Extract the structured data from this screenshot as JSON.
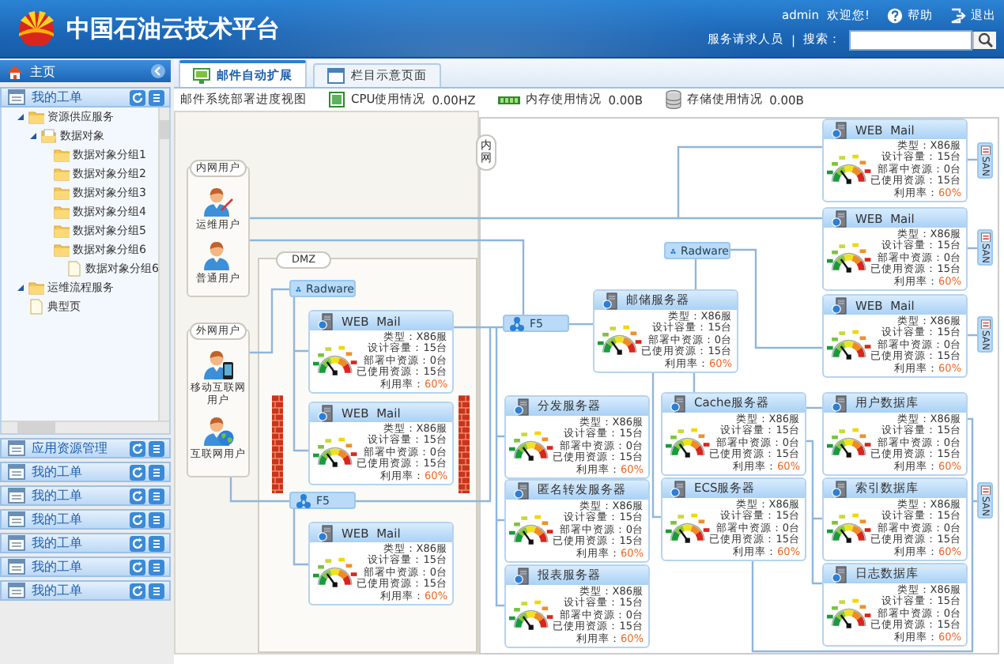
{
  "header": {
    "title": "中国石油云技术平台",
    "user": "admin",
    "welcome": "欢迎您!",
    "help": "帮助",
    "logout": "退出",
    "role": "服务请求人员",
    "separator": "|",
    "search_label": "搜索："
  },
  "sidebar": {
    "home": "主页",
    "panel_title": "我的工单",
    "tree": [
      {
        "label": "资源供应服务",
        "kind": "folder",
        "expanded": true,
        "children": [
          {
            "label": "数据对象",
            "kind": "folder-open",
            "expanded": true,
            "children": [
              {
                "label": "数据对象分组1",
                "kind": "folder"
              },
              {
                "label": "数据对象分组2",
                "kind": "folder"
              },
              {
                "label": "数据对象分组3",
                "kind": "folder"
              },
              {
                "label": "数据对象分组4",
                "kind": "folder"
              },
              {
                "label": "数据对象分组5",
                "kind": "folder"
              },
              {
                "label": "数据对象分组6",
                "kind": "folder",
                "children": [
                  {
                    "label": "数据对象分组6",
                    "kind": "file"
                  }
                ]
              }
            ]
          }
        ]
      },
      {
        "label": "运维流程服务",
        "kind": "folder",
        "expanded": true
      },
      {
        "label": "典型页",
        "kind": "file"
      }
    ],
    "accordions": [
      {
        "label": "应用资源管理"
      },
      {
        "label": "我的工单"
      },
      {
        "label": "我的工单"
      },
      {
        "label": "我的工单"
      },
      {
        "label": "我的工单"
      },
      {
        "label": "我的工单"
      },
      {
        "label": "我的工单"
      }
    ]
  },
  "tabs": [
    {
      "label": "邮件自动扩展",
      "selected": true
    },
    {
      "label": "栏目示意页面",
      "selected": false
    }
  ],
  "toolbar": {
    "title": "邮件系统部署进度视图",
    "metrics": [
      {
        "kind": "cpu",
        "label": "CPU使用情况",
        "value": "0.00HZ"
      },
      {
        "kind": "memory",
        "label": "内存使用情况",
        "value": "0.00B"
      },
      {
        "kind": "storage",
        "label": "存储使用情况",
        "value": "0.00B"
      }
    ]
  },
  "diagram": {
    "zones": [
      {
        "kind": "users",
        "label": "内网用户",
        "users": [
          {
            "kind": "admin",
            "label": "运维用户"
          },
          {
            "kind": "plain",
            "label": "普通用户"
          }
        ]
      },
      {
        "kind": "users",
        "label": "外网用户",
        "users": [
          {
            "kind": "mobile",
            "label": "移动互联网用户"
          },
          {
            "kind": "internet",
            "label": "互联网用户"
          }
        ]
      },
      {
        "kind": "dmz",
        "label": "DMZ"
      },
      {
        "kind": "intranet",
        "label": "内网"
      }
    ],
    "balancers": [
      {
        "label": "Radware"
      },
      {
        "label": "F5"
      },
      {
        "label": "F5"
      },
      {
        "label": "Radware"
      }
    ],
    "servers": [
      {
        "title": "WEB  Mail",
        "stats": [
          {
            "kind": "plain",
            "label": "类型：",
            "value": "X86服"
          },
          {
            "kind": "plain",
            "label": "设计容量：",
            "value": "15台"
          },
          {
            "kind": "plain",
            "label": "部署中资源：",
            "value": "0台"
          },
          {
            "kind": "plain",
            "label": "已使用资源：",
            "value": "15台"
          },
          {
            "kind": "rate",
            "label": "利用率：",
            "value": "60%"
          }
        ]
      },
      {
        "title": "WEB  Mail",
        "stats": [
          {
            "kind": "plain",
            "label": "类型：",
            "value": "X86服"
          },
          {
            "kind": "plain",
            "label": "设计容量：",
            "value": "15台"
          },
          {
            "kind": "plain",
            "label": "部署中资源：",
            "value": "0台"
          },
          {
            "kind": "plain",
            "label": "已使用资源：",
            "value": "15台"
          },
          {
            "kind": "rate",
            "label": "利用率：",
            "value": "60%"
          }
        ]
      },
      {
        "title": "WEB  Mail",
        "stats": [
          {
            "kind": "plain",
            "label": "类型：",
            "value": "X86服"
          },
          {
            "kind": "plain",
            "label": "设计容量：",
            "value": "15台"
          },
          {
            "kind": "plain",
            "label": "部署中资源：",
            "value": "0台"
          },
          {
            "kind": "plain",
            "label": "已使用资源：",
            "value": "15台"
          },
          {
            "kind": "rate",
            "label": "利用率：",
            "value": "60%"
          }
        ]
      },
      {
        "title": "分发服务器",
        "stats": [
          {
            "kind": "plain",
            "label": "类型：",
            "value": "X86服"
          },
          {
            "kind": "plain",
            "label": "设计容量：",
            "value": "15台"
          },
          {
            "kind": "plain",
            "label": "部署中资源：",
            "value": "0台"
          },
          {
            "kind": "plain",
            "label": "已使用资源：",
            "value": "15台"
          },
          {
            "kind": "rate",
            "label": "利用率：",
            "value": "60%"
          }
        ]
      },
      {
        "title": "匿名转发服务器",
        "stats": [
          {
            "kind": "plain",
            "label": "类型：",
            "value": "X86服"
          },
          {
            "kind": "plain",
            "label": "设计容量：",
            "value": "15台"
          },
          {
            "kind": "plain",
            "label": "部署中资源：",
            "value": "0台"
          },
          {
            "kind": "plain",
            "label": "已使用资源：",
            "value": "15台"
          },
          {
            "kind": "rate",
            "label": "利用率：",
            "value": "60%"
          }
        ]
      },
      {
        "title": "报表服务器",
        "stats": [
          {
            "kind": "plain",
            "label": "类型：",
            "value": "X86服"
          },
          {
            "kind": "plain",
            "label": "设计容量：",
            "value": "15台"
          },
          {
            "kind": "plain",
            "label": "部署中资源：",
            "value": "0台"
          },
          {
            "kind": "plain",
            "label": "已使用资源：",
            "value": "15台"
          },
          {
            "kind": "rate",
            "label": "利用率：",
            "value": "60%"
          }
        ]
      },
      {
        "title": "邮储服务器",
        "stats": [
          {
            "kind": "plain",
            "label": "类型：",
            "value": "X86服"
          },
          {
            "kind": "plain",
            "label": "设计容量：",
            "value": "15台"
          },
          {
            "kind": "plain",
            "label": "部署中资源：",
            "value": "0台"
          },
          {
            "kind": "plain",
            "label": "已使用资源：",
            "value": "15台"
          },
          {
            "kind": "rate",
            "label": "利用率：",
            "value": "60%"
          }
        ]
      },
      {
        "title": "Cache服务器",
        "stats": [
          {
            "kind": "plain",
            "label": "类型：",
            "value": "X86服"
          },
          {
            "kind": "plain",
            "label": "设计容量：",
            "value": "15台"
          },
          {
            "kind": "plain",
            "label": "部署中资源：",
            "value": "0台"
          },
          {
            "kind": "plain",
            "label": "已使用资源：",
            "value": "15台"
          },
          {
            "kind": "rate",
            "label": "利用率：",
            "value": "60%"
          }
        ]
      },
      {
        "title": "ECS服务器",
        "stats": [
          {
            "kind": "plain",
            "label": "类型：",
            "value": "X86服"
          },
          {
            "kind": "plain",
            "label": "设计容量：",
            "value": "15台"
          },
          {
            "kind": "plain",
            "label": "部署中资源：",
            "value": "0台"
          },
          {
            "kind": "plain",
            "label": "已使用资源：",
            "value": "15台"
          },
          {
            "kind": "rate",
            "label": "利用率：",
            "value": "60%"
          }
        ]
      },
      {
        "title": "WEB  Mail",
        "stats": [
          {
            "kind": "plain",
            "label": "类型：",
            "value": "X86服"
          },
          {
            "kind": "plain",
            "label": "设计容量：",
            "value": "15台"
          },
          {
            "kind": "plain",
            "label": "部署中资源：",
            "value": "0台"
          },
          {
            "kind": "plain",
            "label": "已使用资源：",
            "value": "15台"
          },
          {
            "kind": "rate",
            "label": "利用率：",
            "value": "60%"
          }
        ]
      },
      {
        "title": "WEB  Mail",
        "stats": [
          {
            "kind": "plain",
            "label": "类型：",
            "value": "X86服"
          },
          {
            "kind": "plain",
            "label": "设计容量：",
            "value": "15台"
          },
          {
            "kind": "plain",
            "label": "部署中资源：",
            "value": "0台"
          },
          {
            "kind": "plain",
            "label": "已使用资源：",
            "value": "15台"
          },
          {
            "kind": "rate",
            "label": "利用率：",
            "value": "60%"
          }
        ]
      },
      {
        "title": "WEB  Mail",
        "stats": [
          {
            "kind": "plain",
            "label": "类型：",
            "value": "X86服"
          },
          {
            "kind": "plain",
            "label": "设计容量：",
            "value": "15台"
          },
          {
            "kind": "plain",
            "label": "部署中资源：",
            "value": "0台"
          },
          {
            "kind": "plain",
            "label": "已使用资源：",
            "value": "15台"
          },
          {
            "kind": "rate",
            "label": "利用率：",
            "value": "60%"
          }
        ]
      },
      {
        "title": "用户数据库",
        "stats": [
          {
            "kind": "plain",
            "label": "类型：",
            "value": "X86服"
          },
          {
            "kind": "plain",
            "label": "设计容量：",
            "value": "15台"
          },
          {
            "kind": "plain",
            "label": "部署中资源：",
            "value": "0台"
          },
          {
            "kind": "plain",
            "label": "已使用资源：",
            "value": "15台"
          },
          {
            "kind": "rate",
            "label": "利用率：",
            "value": "60%"
          }
        ]
      },
      {
        "title": "索引数据库",
        "stats": [
          {
            "kind": "plain",
            "label": "类型：",
            "value": "X86服"
          },
          {
            "kind": "plain",
            "label": "设计容量：",
            "value": "15台"
          },
          {
            "kind": "plain",
            "label": "部署中资源：",
            "value": "0台"
          },
          {
            "kind": "plain",
            "label": "已使用资源：",
            "value": "15台"
          },
          {
            "kind": "rate",
            "label": "利用率：",
            "value": "60%"
          }
        ]
      },
      {
        "title": "日志数据库",
        "stats": [
          {
            "kind": "plain",
            "label": "类型：",
            "value": "X86服"
          },
          {
            "kind": "plain",
            "label": "设计容量：",
            "value": "15台"
          },
          {
            "kind": "plain",
            "label": "部署中资源：",
            "value": "0台"
          },
          {
            "kind": "plain",
            "label": "已使用资源：",
            "value": "15台"
          },
          {
            "kind": "rate",
            "label": "利用率：",
            "value": "60%"
          }
        ]
      }
    ],
    "storage": [
      {
        "label": "SAN"
      },
      {
        "label": "SAN"
      },
      {
        "label": "SAN"
      },
      {
        "label": "SAN"
      }
    ]
  }
}
